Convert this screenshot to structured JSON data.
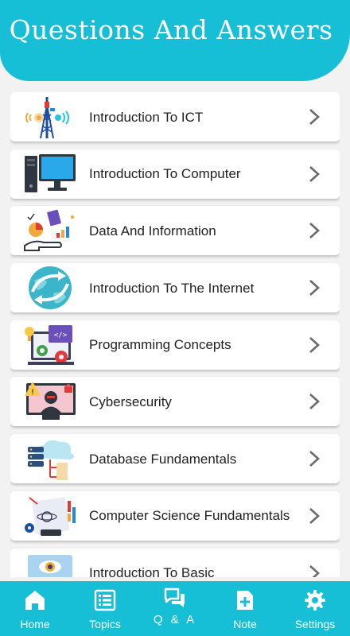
{
  "header": {
    "title": "Questions And Answers"
  },
  "topics": [
    {
      "label": "Introduction To ICT",
      "icon": "ict-tower-icon"
    },
    {
      "label": "Introduction To Computer",
      "icon": "desktop-computer-icon"
    },
    {
      "label": "Data And Information",
      "icon": "data-chart-hand-icon"
    },
    {
      "label": "Introduction To The Internet",
      "icon": "globe-sync-icon"
    },
    {
      "label": "Programming Concepts",
      "icon": "code-monitor-gear-icon"
    },
    {
      "label": "Cybersecurity",
      "icon": "hacker-warning-icon"
    },
    {
      "label": "Database Fundamentals",
      "icon": "database-cloud-icon"
    },
    {
      "label": "Computer Science Fundamentals",
      "icon": "science-tablet-icon"
    },
    {
      "label": "Introduction To Basic",
      "icon": "basic-eye-icon"
    }
  ],
  "nav": {
    "home": "Home",
    "topics": "Topics",
    "qa": "Q & A",
    "note": "Note",
    "settings": "Settings"
  },
  "colors": {
    "accent": "#17bfd6",
    "background": "#f2f2f2",
    "chevron": "#6b6b6b"
  }
}
